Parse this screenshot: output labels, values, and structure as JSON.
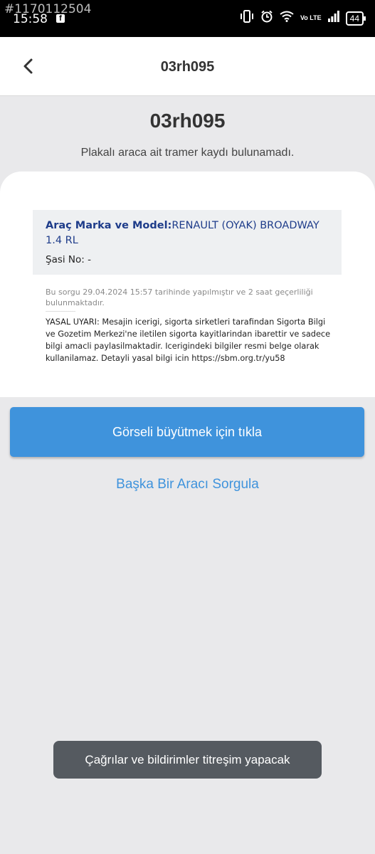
{
  "status_bar": {
    "watermark_id": "#1170112504",
    "time": "15:58",
    "network": "Vo LTE",
    "battery": "44"
  },
  "appbar": {
    "title": "03rh095",
    "back_icon": "chevron-left-icon"
  },
  "result": {
    "plate": "03rh095",
    "message": "Plakalı araca ait tramer kaydı bulunamadı."
  },
  "card": {
    "brand_label": "Araç Marka ve Model:",
    "brand_value": "RENAULT (OYAK) BROADWAY 1.4 RL",
    "chassis_label": "Şasi No: -",
    "query_note": "Bu sorgu 29.04.2024 15:57 tarihinde yapılmıştır ve 2 saat geçerliliği bulunmaktadır.",
    "legal_text": "YASAL UYARI: Mesajin icerigi, sigorta sirketleri tarafindan Sigorta Bilgi ve Gozetim Merkezi'ne iletilen sigorta kayitlarindan ibarettir ve sadece bilgi amacli paylasilmaktadir. Icerigindeki bilgiler resmi belge olarak kullanilamaz. Detayli yasal bilgi icin https://sbm.org.tr/yu58"
  },
  "actions": {
    "enlarge_label": "Görseli büyütmek için tıkla",
    "other_query_label": "Başka Bir Aracı Sorgula"
  },
  "toast": {
    "text": "Çağrılar ve bildirimler titreşim yapacak"
  },
  "colors": {
    "accent": "#3f93dc",
    "brand_text": "#1e3c8a",
    "background": "#e9e9eb"
  }
}
